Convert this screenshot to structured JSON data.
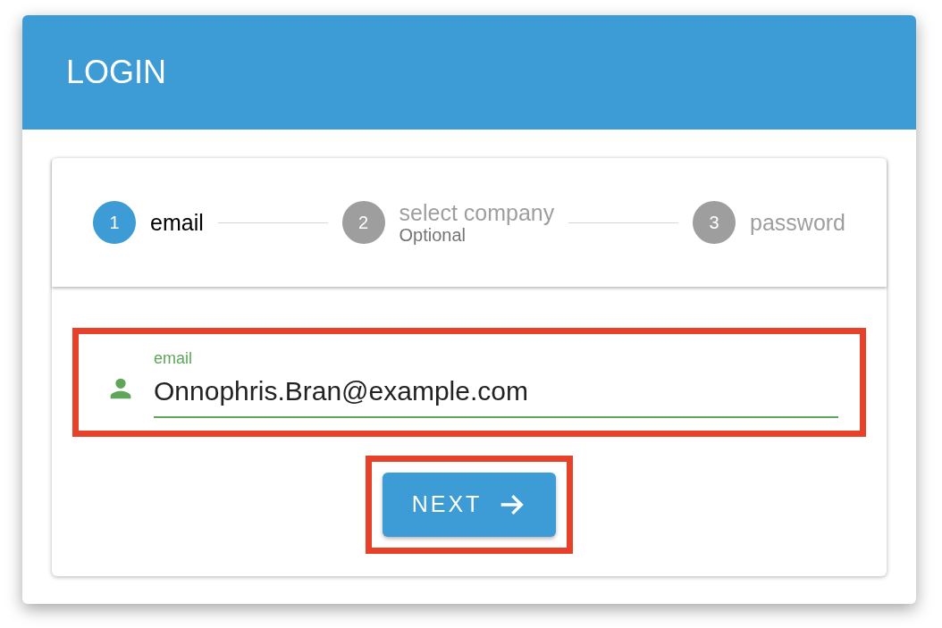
{
  "header": {
    "title": "LOGIN"
  },
  "steps": [
    {
      "number": "1",
      "label": "email",
      "selected": true
    },
    {
      "number": "2",
      "label": "select company",
      "sublabel": "Optional",
      "selected": false
    },
    {
      "number": "3",
      "label": "password",
      "selected": false
    }
  ],
  "email_field": {
    "label": "email",
    "value": "Onnophris.Bran@example.com",
    "highlighted": true
  },
  "next_button": {
    "label": "NEXT",
    "highlighted": true
  }
}
